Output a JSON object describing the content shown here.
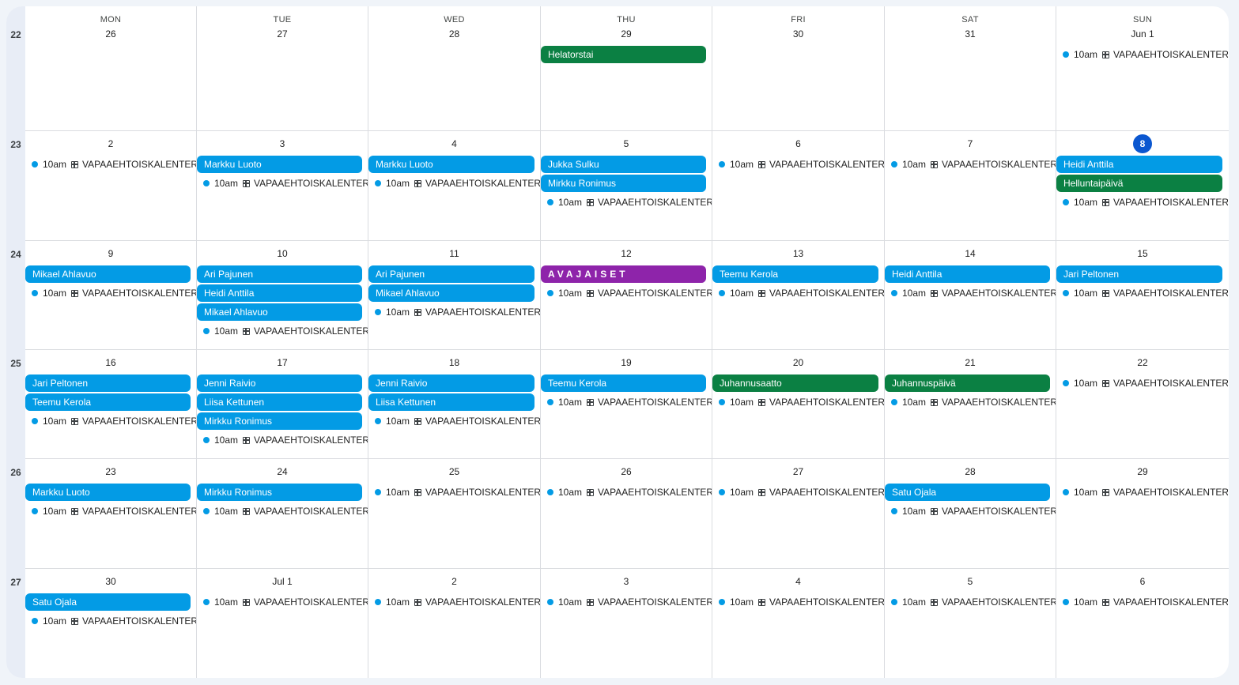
{
  "colors": {
    "accent": "#0b57d0",
    "event_blue": "#039be5",
    "event_green": "#0b8043",
    "event_purple": "#8e24aa"
  },
  "day_headers": [
    "MON",
    "TUE",
    "WED",
    "THU",
    "FRI",
    "SAT",
    "SUN"
  ],
  "today": "8",
  "weeks": [
    {
      "number": "22",
      "days": [
        {
          "date": "26",
          "events": []
        },
        {
          "date": "27",
          "events": []
        },
        {
          "date": "28",
          "events": []
        },
        {
          "date": "29",
          "events": [
            {
              "title": "Helatorstai",
              "color": "green"
            }
          ]
        },
        {
          "date": "30",
          "events": []
        },
        {
          "date": "31",
          "events": []
        },
        {
          "date": "Jun 1",
          "events": [
            {
              "title": "VAPAAEHTOISKALENTERI",
              "time": "10am",
              "timed": true,
              "icon": "table-icon"
            }
          ]
        }
      ]
    },
    {
      "number": "23",
      "days": [
        {
          "date": "2",
          "events": [
            {
              "title": "VAPAAEHTOISKALENTERI",
              "time": "10am",
              "timed": true,
              "icon": "table-icon"
            }
          ]
        },
        {
          "date": "3",
          "events": [
            {
              "title": "Markku Luoto",
              "color": "blue"
            },
            {
              "title": "VAPAAEHTOISKALENTERI",
              "time": "10am",
              "timed": true,
              "icon": "table-icon"
            }
          ]
        },
        {
          "date": "4",
          "events": [
            {
              "title": "Markku Luoto",
              "color": "blue"
            },
            {
              "title": "VAPAAEHTOISKALENTERI",
              "time": "10am",
              "timed": true,
              "icon": "table-icon"
            }
          ]
        },
        {
          "date": "5",
          "events": [
            {
              "title": "Jukka Sulku",
              "color": "blue"
            },
            {
              "title": "Mirkku Ronimus",
              "color": "blue"
            },
            {
              "title": "VAPAAEHTOISKALENTERI",
              "time": "10am",
              "timed": true,
              "icon": "table-icon"
            }
          ]
        },
        {
          "date": "6",
          "events": [
            {
              "title": "VAPAAEHTOISKALENTERI",
              "time": "10am",
              "timed": true,
              "icon": "table-icon"
            }
          ]
        },
        {
          "date": "7",
          "events": [
            {
              "title": "VAPAAEHTOISKALENTERI",
              "time": "10am",
              "timed": true,
              "icon": "table-icon"
            }
          ]
        },
        {
          "date": "8",
          "events": [
            {
              "title": "Heidi Anttila",
              "color": "blue"
            },
            {
              "title": "Helluntaipäivä",
              "color": "green"
            },
            {
              "title": "VAPAAEHTOISKALENTERI",
              "time": "10am",
              "timed": true,
              "icon": "table-icon"
            }
          ]
        }
      ]
    },
    {
      "number": "24",
      "days": [
        {
          "date": "9",
          "events": [
            {
              "title": "Mikael Ahlavuo",
              "color": "blue"
            },
            {
              "title": "VAPAAEHTOISKALENTERI",
              "time": "10am",
              "timed": true,
              "icon": "table-icon"
            }
          ]
        },
        {
          "date": "10",
          "events": [
            {
              "title": "Ari Pajunen",
              "color": "blue"
            },
            {
              "title": "Heidi Anttila",
              "color": "blue"
            },
            {
              "title": "Mikael Ahlavuo",
              "color": "blue"
            },
            {
              "title": "VAPAAEHTOISKALENTERI",
              "time": "10am",
              "timed": true,
              "icon": "table-icon"
            }
          ]
        },
        {
          "date": "11",
          "events": [
            {
              "title": "Ari Pajunen",
              "color": "blue"
            },
            {
              "title": "Mikael Ahlavuo",
              "color": "blue"
            },
            {
              "title": "VAPAAEHTOISKALENTERI",
              "time": "10am",
              "timed": true,
              "icon": "table-icon"
            }
          ]
        },
        {
          "date": "12",
          "events": [
            {
              "title": "AVAJAISET",
              "color": "purple"
            },
            {
              "title": "VAPAAEHTOISKALENTERI",
              "time": "10am",
              "timed": true,
              "icon": "table-icon"
            }
          ]
        },
        {
          "date": "13",
          "events": [
            {
              "title": "Teemu Kerola",
              "color": "blue"
            },
            {
              "title": "VAPAAEHTOISKALENTERI",
              "time": "10am",
              "timed": true,
              "icon": "table-icon"
            }
          ]
        },
        {
          "date": "14",
          "events": [
            {
              "title": "Heidi Anttila",
              "color": "blue"
            },
            {
              "title": "VAPAAEHTOISKALENTERI",
              "time": "10am",
              "timed": true,
              "icon": "table-icon"
            }
          ]
        },
        {
          "date": "15",
          "events": [
            {
              "title": "Jari Peltonen",
              "color": "blue"
            },
            {
              "title": "VAPAAEHTOISKALENTERI",
              "time": "10am",
              "timed": true,
              "icon": "table-icon"
            }
          ]
        }
      ]
    },
    {
      "number": "25",
      "days": [
        {
          "date": "16",
          "events": [
            {
              "title": "Jari Peltonen",
              "color": "blue"
            },
            {
              "title": "Teemu Kerola",
              "color": "blue"
            },
            {
              "title": "VAPAAEHTOISKALENTERI",
              "time": "10am",
              "timed": true,
              "icon": "table-icon"
            }
          ]
        },
        {
          "date": "17",
          "events": [
            {
              "title": "Jenni Raivio",
              "color": "blue"
            },
            {
              "title": "Liisa Kettunen",
              "color": "blue"
            },
            {
              "title": "Mirkku Ronimus",
              "color": "blue"
            },
            {
              "title": "VAPAAEHTOISKALENTERI",
              "time": "10am",
              "timed": true,
              "icon": "table-icon"
            }
          ]
        },
        {
          "date": "18",
          "events": [
            {
              "title": "Jenni Raivio",
              "color": "blue"
            },
            {
              "title": "Liisa Kettunen",
              "color": "blue"
            },
            {
              "title": "VAPAAEHTOISKALENTERI",
              "time": "10am",
              "timed": true,
              "icon": "table-icon"
            }
          ]
        },
        {
          "date": "19",
          "events": [
            {
              "title": "Teemu Kerola",
              "color": "blue"
            },
            {
              "title": "VAPAAEHTOISKALENTERI",
              "time": "10am",
              "timed": true,
              "icon": "table-icon"
            }
          ]
        },
        {
          "date": "20",
          "events": [
            {
              "title": "Juhannusaatto",
              "color": "green"
            },
            {
              "title": "VAPAAEHTOISKALENTERI",
              "time": "10am",
              "timed": true,
              "icon": "table-icon"
            }
          ]
        },
        {
          "date": "21",
          "events": [
            {
              "title": "Juhannuspäivä",
              "color": "green"
            },
            {
              "title": "VAPAAEHTOISKALENTERI",
              "time": "10am",
              "timed": true,
              "icon": "table-icon"
            }
          ]
        },
        {
          "date": "22",
          "events": [
            {
              "title": "VAPAAEHTOISKALENTERI",
              "time": "10am",
              "timed": true,
              "icon": "table-icon"
            }
          ]
        }
      ]
    },
    {
      "number": "26",
      "days": [
        {
          "date": "23",
          "events": [
            {
              "title": "Markku Luoto",
              "color": "blue"
            },
            {
              "title": "VAPAAEHTOISKALENTERI",
              "time": "10am",
              "timed": true,
              "icon": "table-icon"
            }
          ]
        },
        {
          "date": "24",
          "events": [
            {
              "title": "Mirkku Ronimus",
              "color": "blue"
            },
            {
              "title": "VAPAAEHTOISKALENTERI",
              "time": "10am",
              "timed": true,
              "icon": "table-icon"
            }
          ]
        },
        {
          "date": "25",
          "events": [
            {
              "title": "VAPAAEHTOISKALENTERI",
              "time": "10am",
              "timed": true,
              "icon": "table-icon"
            }
          ]
        },
        {
          "date": "26",
          "events": [
            {
              "title": "VAPAAEHTOISKALENTERI",
              "time": "10am",
              "timed": true,
              "icon": "table-icon"
            }
          ]
        },
        {
          "date": "27",
          "events": [
            {
              "title": "VAPAAEHTOISKALENTERI",
              "time": "10am",
              "timed": true,
              "icon": "table-icon"
            }
          ]
        },
        {
          "date": "28",
          "events": [
            {
              "title": "Satu Ojala",
              "color": "blue"
            },
            {
              "title": "VAPAAEHTOISKALENTERI",
              "time": "10am",
              "timed": true,
              "icon": "table-icon"
            }
          ]
        },
        {
          "date": "29",
          "events": [
            {
              "title": "VAPAAEHTOISKALENTERI",
              "time": "10am",
              "timed": true,
              "icon": "table-icon"
            }
          ]
        }
      ]
    },
    {
      "number": "27",
      "days": [
        {
          "date": "30",
          "events": [
            {
              "title": "Satu Ojala",
              "color": "blue"
            },
            {
              "title": "VAPAAEHTOISKALENTERI",
              "time": "10am",
              "timed": true,
              "icon": "table-icon"
            }
          ]
        },
        {
          "date": "Jul 1",
          "events": [
            {
              "title": "VAPAAEHTOISKALENTERI",
              "time": "10am",
              "timed": true,
              "icon": "table-icon"
            }
          ]
        },
        {
          "date": "2",
          "events": [
            {
              "title": "VAPAAEHTOISKALENTERI",
              "time": "10am",
              "timed": true,
              "icon": "table-icon"
            }
          ]
        },
        {
          "date": "3",
          "events": [
            {
              "title": "VAPAAEHTOISKALENTERI",
              "time": "10am",
              "timed": true,
              "icon": "table-icon"
            }
          ]
        },
        {
          "date": "4",
          "events": [
            {
              "title": "VAPAAEHTOISKALENTERI",
              "time": "10am",
              "timed": true,
              "icon": "table-icon"
            }
          ]
        },
        {
          "date": "5",
          "events": [
            {
              "title": "VAPAAEHTOISKALENTERI",
              "time": "10am",
              "timed": true,
              "icon": "table-icon"
            }
          ]
        },
        {
          "date": "6",
          "events": [
            {
              "title": "VAPAAEHTOISKALENTERI",
              "time": "10am",
              "timed": true,
              "icon": "table-icon"
            }
          ]
        }
      ]
    }
  ]
}
